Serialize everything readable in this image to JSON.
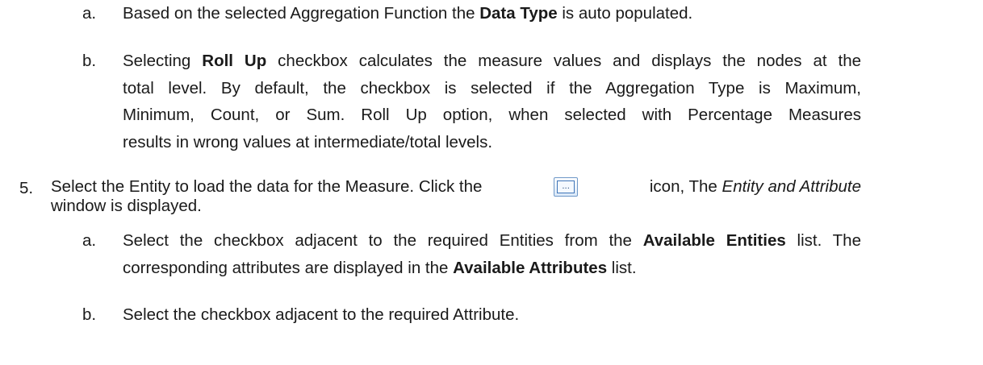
{
  "items": [
    {
      "marker": "a.",
      "lines": [
        {
          "pre": "Based on the selected Aggregation Function the ",
          "bold": "Data Type",
          "post": " is auto populated."
        }
      ]
    },
    {
      "marker": "b.",
      "lines": [
        {
          "pre": "Selecting ",
          "bold": "Roll Up",
          "post": " checkbox calculates the measure values and displays the nodes at the"
        },
        {
          "text": "total level. By default, the checkbox is selected if the Aggregation Type is Maximum,"
        },
        {
          "text": "Minimum, Count, or Sum. Roll Up option, when selected with Percentage Measures"
        },
        {
          "text": "results in wrong values at intermediate/total levels."
        }
      ]
    },
    {
      "marker": "5.",
      "lines": [
        {
          "pre": "Select the Entity to load the data for the Measure. Click the",
          "post": "icon, The ",
          "italic": "Entity and Attribute"
        },
        {
          "text": "window is displayed."
        }
      ],
      "icon": "browse-ellipsis-icon",
      "icon_glyph": "..."
    },
    {
      "marker": "a.",
      "lines": [
        {
          "pre": "Select the checkbox adjacent to the required Entities from the ",
          "bold": "Available Entities",
          "post": " list. The"
        },
        {
          "pre": "corresponding attributes are displayed in the ",
          "bold": "Available Attributes",
          "post": " list."
        }
      ]
    },
    {
      "marker": "b.",
      "lines": [
        {
          "text": "Select the checkbox adjacent to the required Attribute."
        }
      ]
    }
  ]
}
